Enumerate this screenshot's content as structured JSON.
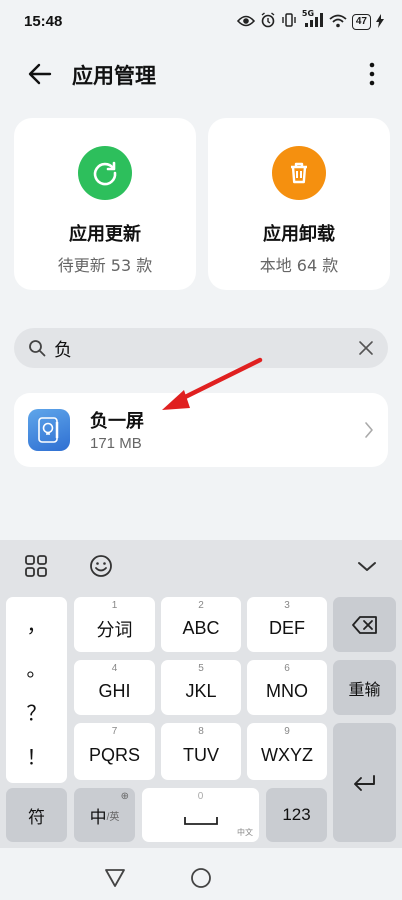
{
  "status_bar": {
    "time": "15:48",
    "network": "5G",
    "battery": "47",
    "icons": [
      "eye-icon",
      "alarm-icon",
      "vibrate-icon",
      "signal-icon",
      "wifi-icon",
      "battery-icon",
      "charging-icon"
    ]
  },
  "header": {
    "title": "应用管理",
    "back_icon": "arrow-left-icon",
    "more_icon": "more-vertical-icon"
  },
  "cards": {
    "update": {
      "title": "应用更新",
      "subtitle": "待更新 53 款",
      "color": "#2dbf5c"
    },
    "uninstall": {
      "title": "应用卸载",
      "subtitle": "本地 64 款",
      "color": "#f5900f"
    }
  },
  "search": {
    "value": "负",
    "icon": "search-icon",
    "clear_icon": "close-icon"
  },
  "results": [
    {
      "name": "负一屏",
      "size": "171 MB",
      "icon": "app-icon"
    }
  ],
  "keyboard": {
    "top_icons": [
      "grid-icon",
      "emoji-icon",
      "chevron-down-icon"
    ],
    "punctuation": [
      "，",
      "。",
      "？",
      "！"
    ],
    "keys": [
      {
        "num": "1",
        "label": "分词"
      },
      {
        "num": "2",
        "label": "ABC"
      },
      {
        "num": "3",
        "label": "DEF"
      },
      {
        "num": "4",
        "label": "GHI"
      },
      {
        "num": "5",
        "label": "JKL"
      },
      {
        "num": "6",
        "label": "MNO"
      },
      {
        "num": "7",
        "label": "PQRS"
      },
      {
        "num": "8",
        "label": "TUV"
      },
      {
        "num": "9",
        "label": "WXYZ"
      }
    ],
    "reenter_label": "重输",
    "symbol_label": "符",
    "lang_main": "中",
    "lang_sub": "/英",
    "space_num": "0",
    "space_hint": "中文",
    "number_label": "123"
  },
  "navbar": {
    "icons": [
      "back-triangle-icon",
      "home-circle-icon"
    ]
  }
}
